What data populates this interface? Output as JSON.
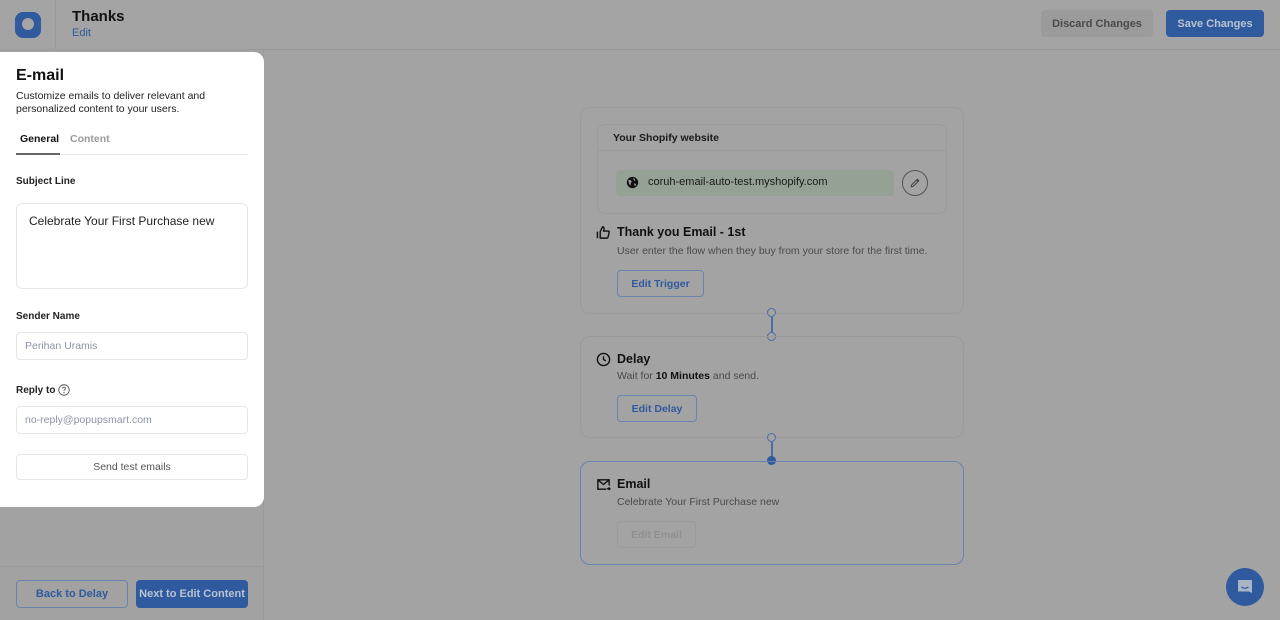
{
  "header": {
    "title": "Thanks",
    "edit_link": "Edit",
    "discard_label": "Discard Changes",
    "save_label": "Save Changes"
  },
  "panel": {
    "title": "E-mail",
    "description": "Customize emails to deliver relevant and personalized content to your users.",
    "tabs": [
      {
        "label": "General",
        "active": true
      },
      {
        "label": "Content",
        "active": false
      }
    ],
    "subject_label": "Subject Line",
    "subject_value": "Celebrate Your First Purchase new",
    "sender_label": "Sender Name",
    "sender_placeholder": "Perihan Uramis",
    "reply_label": "Reply to",
    "reply_placeholder": "no-reply@popupsmart.com",
    "test_button": "Send test emails"
  },
  "footer": {
    "back_label": "Back to Delay",
    "next_label": "Next to Edit Content"
  },
  "flow": {
    "website_title": "Your Shopify website",
    "website_url": "coruh-email-auto-test.myshopify.com",
    "trigger": {
      "title": "Thank you Email - 1st",
      "description": "User enter the flow when they buy from your store for the first time.",
      "button": "Edit Trigger"
    },
    "delay": {
      "title": "Delay",
      "desc_prefix": "Wait for ",
      "desc_value": "10 Minutes",
      "desc_suffix": " and send.",
      "button": "Edit Delay"
    },
    "email": {
      "title": "Email",
      "description": "Celebrate Your First Purchase new",
      "button": "Edit Email"
    }
  },
  "colors": {
    "accent": "#2f5a9e",
    "overlay": "#a3a3a3"
  }
}
